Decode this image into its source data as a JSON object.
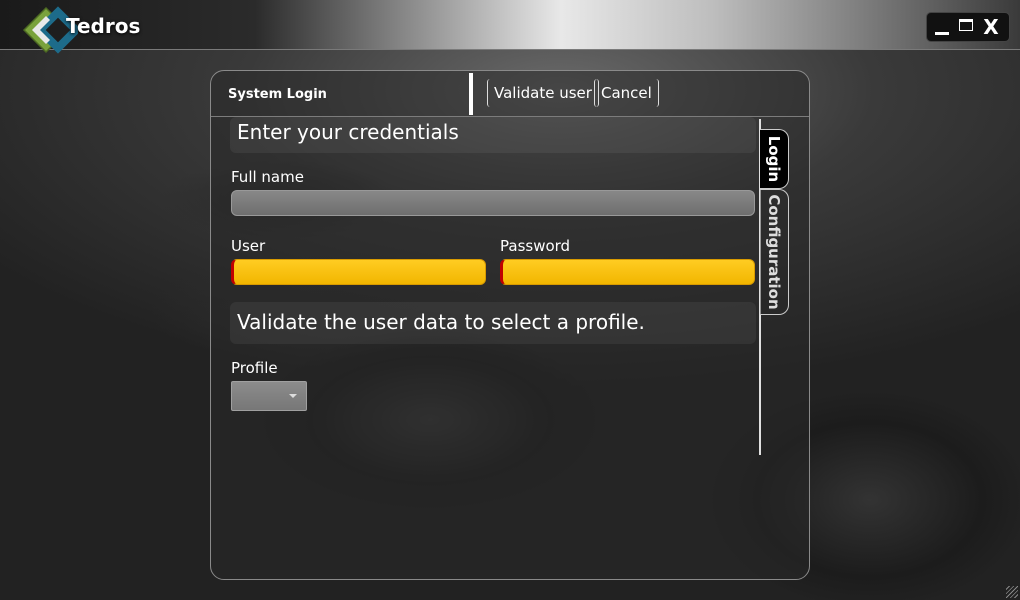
{
  "window": {
    "app_title": "Tedros",
    "controls": {
      "minimize": "_",
      "maximize": "▬",
      "close": "X"
    }
  },
  "panel": {
    "title": "System Login",
    "toolbar": {
      "validate_label": "Validate user",
      "cancel_label": "Cancel"
    },
    "credentials_heading": "Enter your credentials",
    "full_name_label": "Full name",
    "full_name_value": "",
    "user_label": "User",
    "user_value": "",
    "password_label": "Password",
    "password_value": "",
    "profile_heading": "Validate the user data to select a profile.",
    "profile_label": "Profile",
    "profile_value": "",
    "tabs": [
      {
        "label": "Login",
        "active": true
      },
      {
        "label": "Configuration",
        "active": false
      }
    ]
  },
  "colors": {
    "required_field": "#ffc61a",
    "required_marker": "#c00000",
    "disabled_field": "#7a7a7a",
    "logo_green": "#7aa23c",
    "logo_teal": "#1d6b8a"
  },
  "icons": {
    "logo": "tedros-logo-icon",
    "dropdown": "chevron-down-icon",
    "resize": "resize-grip-icon"
  }
}
